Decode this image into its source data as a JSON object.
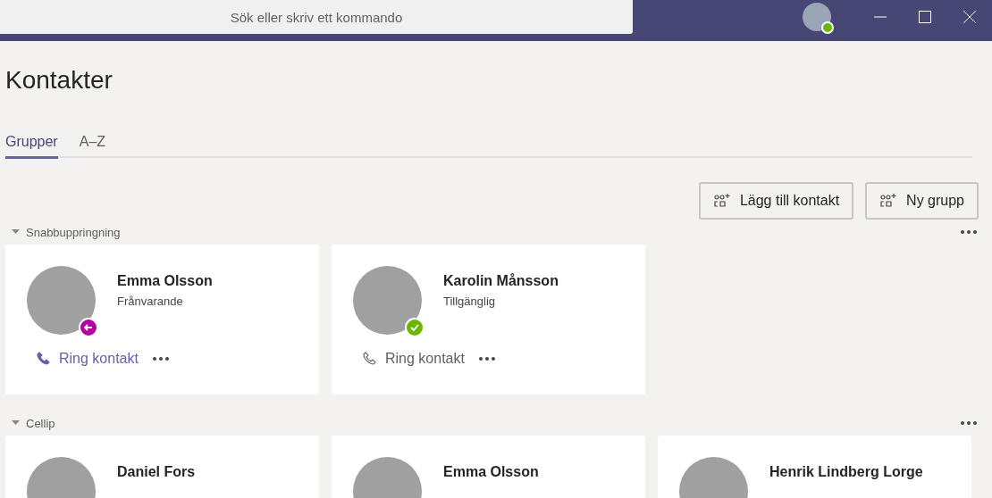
{
  "titlebar": {
    "search": {
      "placeholder": "Sök eller skriv ett kommando"
    }
  },
  "page": {
    "title": "Kontakter"
  },
  "tabs": [
    {
      "label": "Grupper",
      "selected": true
    },
    {
      "label": "A–Z",
      "selected": false
    }
  ],
  "actions": [
    {
      "label": "Lägg till kontakt"
    },
    {
      "label": "Ny grupp"
    }
  ],
  "groups": [
    {
      "name": "Snabbuppringning",
      "expanded": true,
      "contacts": [
        {
          "name": "Emma Olsson",
          "status": "Frånvarande",
          "kind": "away",
          "color": "#b4009e",
          "call": "Ring kontakt",
          "hovered": true
        },
        {
          "name": "Karolin Månsson",
          "status": "Tillgänglig",
          "kind": "available",
          "color": "#6bb700",
          "call": "Ring kontakt",
          "hovered": false
        }
      ]
    },
    {
      "name": "Cellip",
      "expanded": true,
      "contacts": [
        {
          "name": "Daniel Fors"
        },
        {
          "name": "Emma Olsson"
        },
        {
          "name": "Henrik Lindberg Lorge"
        }
      ]
    }
  ]
}
